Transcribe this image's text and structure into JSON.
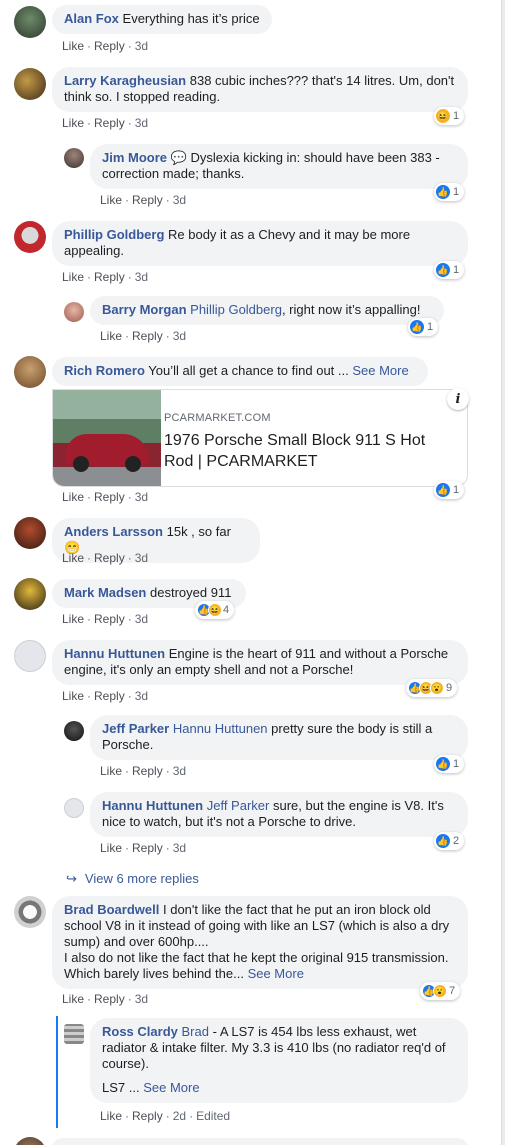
{
  "actions": {
    "like": "Like",
    "reply": "Reply",
    "edited": "Edited"
  },
  "see_more": "See More",
  "comments": [
    {
      "author": "Alan Fox",
      "text": "Everything has it’s price",
      "time": "3d"
    },
    {
      "author": "Larry Karagheusian",
      "text": "838 cubic inches??? that's 14 litres. Um, don't think so. I stopped reading.",
      "time": "3d",
      "reaction_count": "1"
    },
    {
      "author": "Jim Moore",
      "author_icon": "speech-bubble-icon",
      "text": "Dyslexia kicking in: should have been 383 - correction made; thanks.",
      "time": "3d",
      "reaction_count": "1"
    },
    {
      "author": "Phillip Goldberg",
      "text": "Re body it as a Chevy and it may be more appealing.",
      "time": "3d",
      "reaction_count": "1"
    },
    {
      "author": "Barry Morgan",
      "mention": "Phillip Goldberg",
      "text": ", right now it’s appalling!",
      "time": "3d",
      "reaction_count": "1"
    },
    {
      "author": "Rich Romero",
      "text": "You’ll all get a chance to find out ...",
      "time": "3d",
      "reaction_count": "1",
      "link_card": {
        "site": "PCARMARKET.COM",
        "title": "1976 Porsche Small Block 911 S Hot Rod | PCARMARKET"
      }
    },
    {
      "author": "Anders Larsson",
      "text": "15k , so far 😁",
      "time": "3d"
    },
    {
      "author": "Mark Madsen",
      "text": "destroyed 911",
      "time": "3d",
      "reaction_count": "4"
    },
    {
      "author": "Hannu Huttunen",
      "text": "Engine is the heart of 911 and without a Porsche engine, it's only an empty shell and not a Porsche!",
      "time": "3d",
      "reaction_count": "9"
    },
    {
      "author": "Jeff Parker",
      "mention": "Hannu Huttunen",
      "text": "pretty sure the body is still a Porsche.",
      "time": "3d",
      "reaction_count": "1"
    },
    {
      "author": "Hannu Huttunen",
      "mention": "Jeff Parker",
      "text": "sure, but the engine is V8. It's nice to watch, but it's not a Porsche to drive.",
      "time": "3d",
      "reaction_count": "2"
    },
    {
      "author": "Brad Boardwell",
      "text": "I don't like the fact that he put an iron block old school V8 in it instead of going with like an LS7 (which is also a dry sump) and over 600hp....",
      "text2": "I also do not like the fact that he kept the original 915 transmission. Which barely lives behind the...",
      "time": "3d",
      "reaction_count": "7"
    },
    {
      "author": "Ross Clardy",
      "mention": "Brad",
      "text": "- A LS7 is 454 lbs less exhaust, wet radiator & intake filter. My 3.3 is 410 lbs (no radiator req'd of course).",
      "text2": "LS7 ...",
      "time": "2d"
    }
  ],
  "view_more_replies": "View 6 more replies",
  "colors": {
    "link": "#385898",
    "bubble": "#f2f3f5",
    "like": "#1877f2",
    "haha": "#f7b125"
  }
}
